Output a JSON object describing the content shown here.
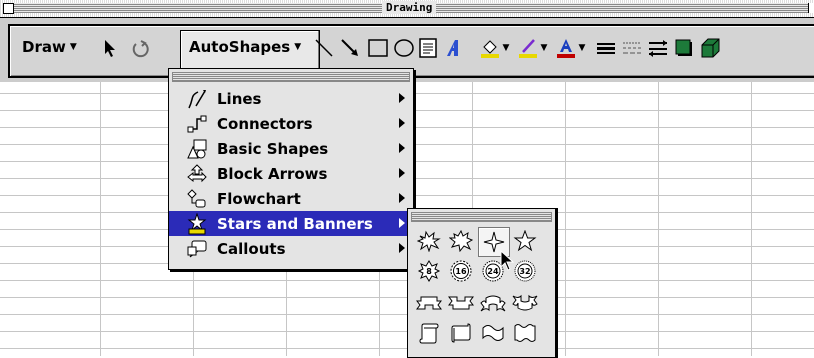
{
  "window": {
    "title": "Drawing"
  },
  "toolbar": {
    "draw_label": "Draw",
    "autoshapes_label": "AutoShapes",
    "tools": [
      "select-arrow",
      "free-rotate",
      "line",
      "arrow",
      "rectangle",
      "oval",
      "text-box",
      "word-art",
      "fill-color",
      "line-color",
      "font-color",
      "line-style",
      "dash-style",
      "arrow-style",
      "shadow",
      "3d"
    ]
  },
  "menu": {
    "items": [
      {
        "label": "Lines",
        "icon": "lines-icon"
      },
      {
        "label": "Connectors",
        "icon": "connectors-icon"
      },
      {
        "label": "Basic Shapes",
        "icon": "basic-shapes-icon"
      },
      {
        "label": "Block Arrows",
        "icon": "block-arrows-icon"
      },
      {
        "label": "Flowchart",
        "icon": "flowchart-icon"
      },
      {
        "label": "Stars and Banners",
        "icon": "stars-banners-icon",
        "selected": true
      },
      {
        "label": "Callouts",
        "icon": "callouts-icon"
      }
    ]
  },
  "submenu": {
    "seal_numbers": [
      "8",
      "16",
      "24",
      "32"
    ],
    "shapes": [
      "explosion-1",
      "explosion-2",
      "4-point-star",
      "5-point-star",
      "8-point-star",
      "16-point-star",
      "24-point-star",
      "32-point-star",
      "up-ribbon",
      "down-ribbon",
      "curved-up-ribbon",
      "curved-down-ribbon",
      "vertical-scroll",
      "horizontal-scroll",
      "wave",
      "double-wave"
    ],
    "highlighted": "4-point-star"
  },
  "colors": {
    "menu_selection": "#2b2bb8",
    "fill_accent": "#e8d800",
    "font_accent": "#c00000",
    "line_accent": "#7a2bd0"
  }
}
